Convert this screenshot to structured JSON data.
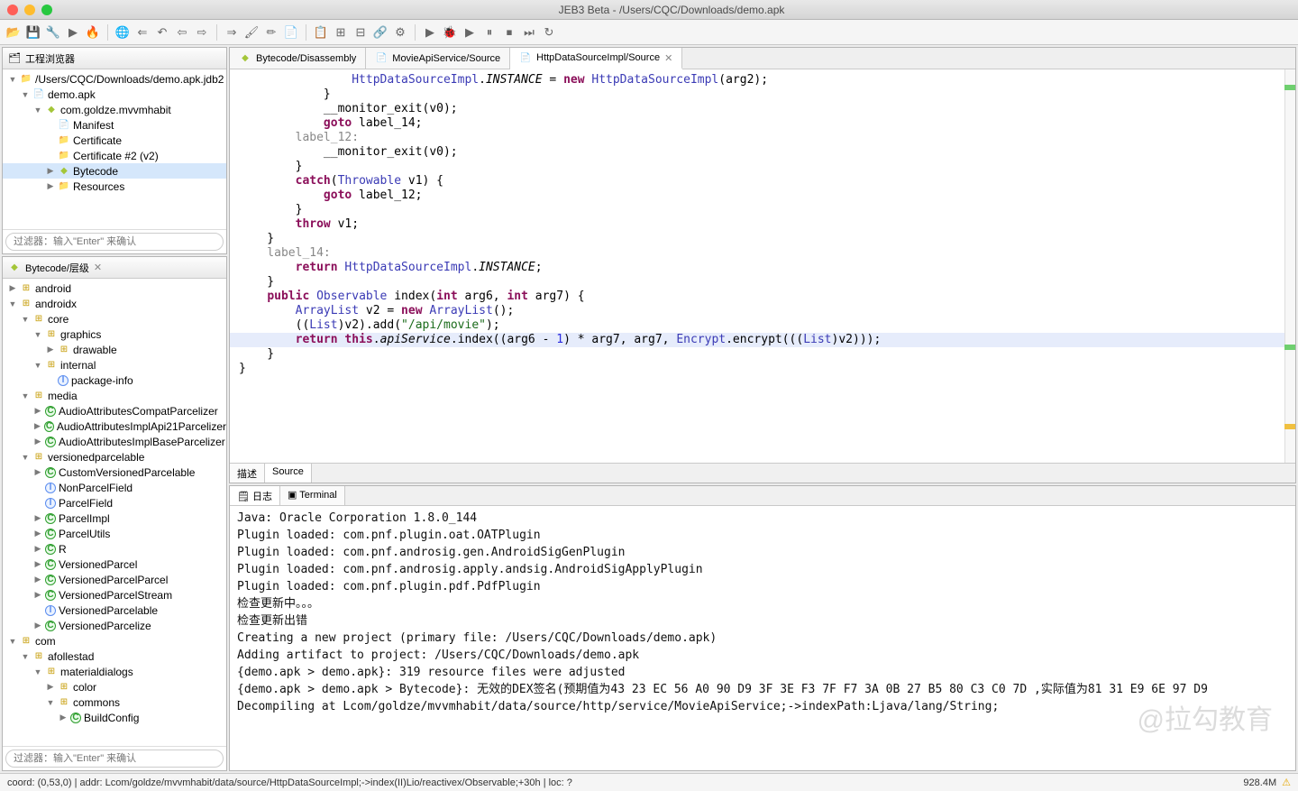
{
  "window": {
    "title": "JEB3 Beta - /Users/CQC/Downloads/demo.apk"
  },
  "toolbarIcons": [
    "📂",
    "💾",
    "🔧",
    "▶",
    "🔥",
    "🌐",
    "⇐",
    "↶",
    "⇦",
    "⇨",
    "⇒",
    "🖌",
    "✏",
    "📄",
    "📋",
    "⊞",
    "⊟",
    "🔗",
    "⚙",
    "▶",
    "🐞",
    "▶",
    "⏸",
    "⏹",
    "⏭",
    "↻"
  ],
  "projectPanel": {
    "title": "工程浏览器",
    "filterPlaceholder": "过滤器：输入\"Enter\" 来确认",
    "items": [
      {
        "depth": 0,
        "caret": "▼",
        "ico": "folder",
        "label": "/Users/CQC/Downloads/demo.apk.jdb2"
      },
      {
        "depth": 1,
        "caret": "▼",
        "ico": "file",
        "label": "demo.apk"
      },
      {
        "depth": 2,
        "caret": "▼",
        "ico": "android",
        "label": "com.goldze.mvvmhabit"
      },
      {
        "depth": 3,
        "caret": "",
        "ico": "file",
        "label": "Manifest"
      },
      {
        "depth": 3,
        "caret": "",
        "ico": "folder",
        "label": "Certificate"
      },
      {
        "depth": 3,
        "caret": "",
        "ico": "folder",
        "label": "Certificate #2 (v2)"
      },
      {
        "depth": 3,
        "caret": "▶",
        "ico": "android",
        "label": "Bytecode",
        "sel": true
      },
      {
        "depth": 3,
        "caret": "▶",
        "ico": "folder",
        "label": "Resources"
      }
    ]
  },
  "hierPanel": {
    "title": "Bytecode/层级",
    "filterPlaceholder": "过滤器：输入\"Enter\" 来确认",
    "items": [
      {
        "depth": 0,
        "caret": "▶",
        "ico": "pkg",
        "label": "android"
      },
      {
        "depth": 0,
        "caret": "▼",
        "ico": "pkg",
        "label": "androidx"
      },
      {
        "depth": 1,
        "caret": "▼",
        "ico": "pkg",
        "label": "core"
      },
      {
        "depth": 2,
        "caret": "▼",
        "ico": "pkg",
        "label": "graphics"
      },
      {
        "depth": 3,
        "caret": "▶",
        "ico": "pkg",
        "label": "drawable"
      },
      {
        "depth": 2,
        "caret": "▼",
        "ico": "pkg",
        "label": "internal"
      },
      {
        "depth": 3,
        "caret": "",
        "ico": "iface",
        "label": "package-info"
      },
      {
        "depth": 1,
        "caret": "▼",
        "ico": "pkg",
        "label": "media"
      },
      {
        "depth": 2,
        "caret": "▶",
        "ico": "cls",
        "label": "AudioAttributesCompatParcelizer"
      },
      {
        "depth": 2,
        "caret": "▶",
        "ico": "cls",
        "label": "AudioAttributesImplApi21Parcelizer"
      },
      {
        "depth": 2,
        "caret": "▶",
        "ico": "cls",
        "label": "AudioAttributesImplBaseParcelizer"
      },
      {
        "depth": 1,
        "caret": "▼",
        "ico": "pkg",
        "label": "versionedparcelable"
      },
      {
        "depth": 2,
        "caret": "▶",
        "ico": "cls",
        "label": "CustomVersionedParcelable"
      },
      {
        "depth": 2,
        "caret": "",
        "ico": "iface",
        "label": "NonParcelField"
      },
      {
        "depth": 2,
        "caret": "",
        "ico": "iface",
        "label": "ParcelField"
      },
      {
        "depth": 2,
        "caret": "▶",
        "ico": "cls",
        "label": "ParcelImpl"
      },
      {
        "depth": 2,
        "caret": "▶",
        "ico": "cls",
        "label": "ParcelUtils"
      },
      {
        "depth": 2,
        "caret": "▶",
        "ico": "cls",
        "label": "R"
      },
      {
        "depth": 2,
        "caret": "▶",
        "ico": "cls",
        "label": "VersionedParcel"
      },
      {
        "depth": 2,
        "caret": "▶",
        "ico": "cls",
        "label": "VersionedParcelParcel"
      },
      {
        "depth": 2,
        "caret": "▶",
        "ico": "cls",
        "label": "VersionedParcelStream"
      },
      {
        "depth": 2,
        "caret": "",
        "ico": "iface",
        "label": "VersionedParcelable"
      },
      {
        "depth": 2,
        "caret": "▶",
        "ico": "cls",
        "label": "VersionedParcelize"
      },
      {
        "depth": 0,
        "caret": "▼",
        "ico": "pkg",
        "label": "com"
      },
      {
        "depth": 1,
        "caret": "▼",
        "ico": "pkg",
        "label": "afollestad"
      },
      {
        "depth": 2,
        "caret": "▼",
        "ico": "pkg",
        "label": "materialdialogs"
      },
      {
        "depth": 3,
        "caret": "▶",
        "ico": "pkg",
        "label": "color"
      },
      {
        "depth": 3,
        "caret": "▼",
        "ico": "pkg",
        "label": "commons"
      },
      {
        "depth": 4,
        "caret": "▶",
        "ico": "cls",
        "label": "BuildConfig"
      }
    ]
  },
  "editorTabs": [
    {
      "ico": "android",
      "label": "Bytecode/Disassembly",
      "active": false
    },
    {
      "ico": "file",
      "label": "MovieApiService/Source",
      "active": false
    },
    {
      "ico": "file",
      "label": "HttpDataSourceImpl/Source",
      "active": true
    }
  ],
  "subTabs": [
    "描述",
    "Source"
  ],
  "bottomTabs": [
    {
      "ico": "🗒",
      "label": "日志",
      "active": true
    },
    {
      "ico": "▣",
      "label": "Terminal",
      "active": false
    }
  ],
  "console": [
    "Java: Oracle Corporation 1.8.0_144",
    "Plugin loaded: com.pnf.plugin.oat.OATPlugin",
    "Plugin loaded: com.pnf.androsig.gen.AndroidSigGenPlugin",
    "Plugin loaded: com.pnf.androsig.apply.andsig.AndroidSigApplyPlugin",
    "Plugin loaded: com.pnf.plugin.pdf.PdfPlugin",
    "检查更新中。。。",
    "检查更新出错",
    "Creating a new project (primary file: /Users/CQC/Downloads/demo.apk)",
    "Adding artifact to project: /Users/CQC/Downloads/demo.apk",
    "{demo.apk > demo.apk}: 319 resource files were adjusted",
    "{demo.apk > demo.apk > Bytecode}: 无效的DEX签名(预期值为43 23 EC 56 A0 90 D9 3F 3E F3 7F F7 3A 0B 27 B5 80 C3 C0 7D ,实际值为81 31 E9 6E 97 D9",
    "Decompiling at Lcom/goldze/mvvmhabit/data/source/http/service/MovieApiService;->indexPath:Ljava/lang/String;"
  ],
  "status": {
    "left": "coord: (0,53,0) | addr: Lcom/goldze/mvvmhabit/data/source/HttpDataSourceImpl;->index(II)Lio/reactivex/Observable;+30h | loc: ?",
    "mem": "928.4M"
  },
  "code": {
    "l1a": "HttpDataSourceImpl",
    "l1b": ".",
    "l1c": "INSTANCE",
    "l1d": " = ",
    "l1e": "new",
    "l1f": " ",
    "l1g": "HttpDataSourceImpl",
    "l1h": "(arg2);",
    "l2": "            }",
    "l3": "",
    "l4": "            __monitor_exit(v0);",
    "l5a": "            ",
    "l5b": "goto",
    "l5c": " label_14;",
    "l6": "        label_12:",
    "l7": "            __monitor_exit(v0);",
    "l8": "        }",
    "l9a": "        ",
    "l9b": "catch",
    "l9c": "(",
    "l9d": "Throwable",
    "l9e": " v1) {",
    "l10a": "            ",
    "l10b": "goto",
    "l10c": " label_12;",
    "l11": "        }",
    "l12": "",
    "l13a": "        ",
    "l13b": "throw",
    "l13c": " v1;",
    "l14": "    }",
    "l15": "",
    "l16": "    label_14:",
    "l17a": "        ",
    "l17b": "return",
    "l17c": " ",
    "l17d": "HttpDataSourceImpl",
    "l17e": ".",
    "l17f": "INSTANCE",
    "l17g": ";",
    "l18": "    }",
    "l19": "",
    "l20a": "    ",
    "l20b": "public",
    "l20c": " ",
    "l20d": "Observable",
    "l20e": " index(",
    "l20f": "int",
    "l20g": " arg6, ",
    "l20h": "int",
    "l20i": " arg7) {",
    "l21a": "        ",
    "l21b": "ArrayList",
    "l21c": " v2 = ",
    "l21d": "new",
    "l21e": " ",
    "l21f": "ArrayList",
    "l21g": "();",
    "l22a": "        ((",
    "l22b": "List",
    "l22c": ")v2).add(",
    "l22d": "\"/api/movie\"",
    "l22e": ");",
    "l23a": "        ",
    "l23b": "return",
    "l23c": " ",
    "l23d": "this",
    "l23e": ".",
    "l23f": "apiService",
    "l23g": ".index((arg6 - ",
    "l23h": "1",
    "l23i": ") * arg7, arg7, ",
    "l23j": "Encrypt",
    "l23k": ".encrypt(((",
    "l23l": "List",
    "l23m": ")v2)));",
    "l24": "    }",
    "l25": "}"
  },
  "watermark": "@拉勾教育"
}
